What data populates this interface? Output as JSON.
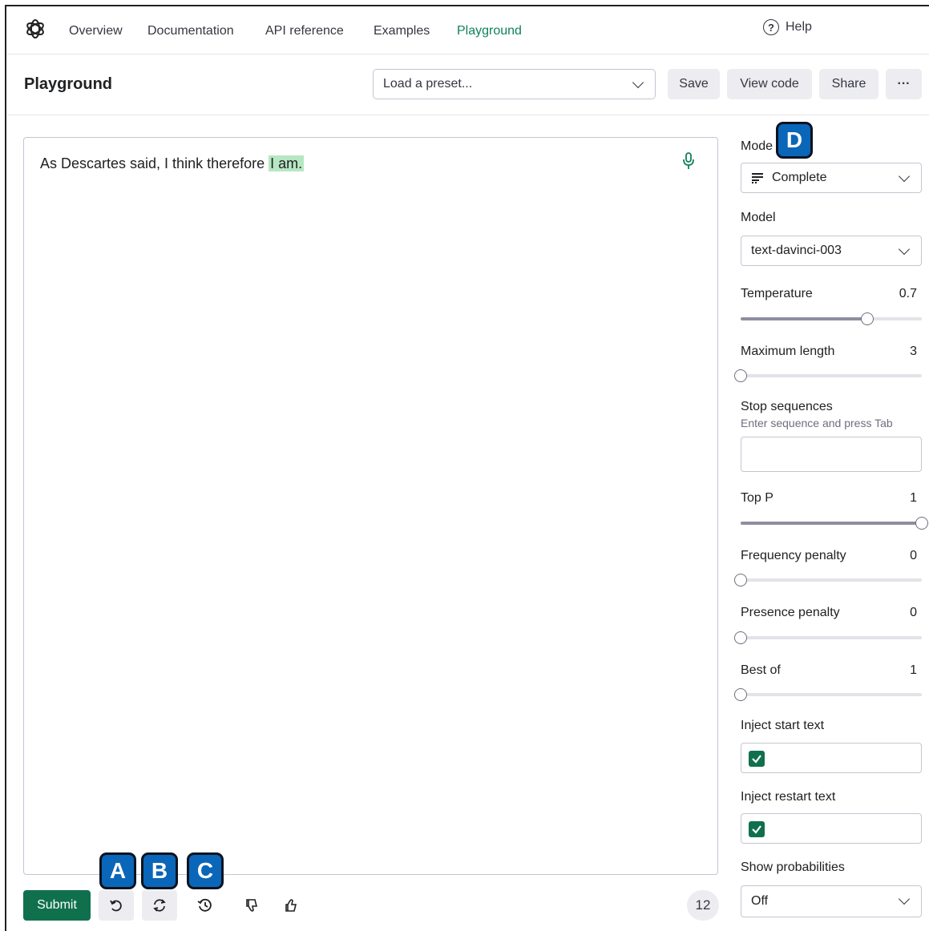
{
  "nav": {
    "items": [
      "Overview",
      "Documentation",
      "API reference",
      "Examples",
      "Playground"
    ],
    "active": "Playground",
    "help": "Help"
  },
  "header": {
    "title": "Playground",
    "preset_placeholder": "Load a preset...",
    "save": "Save",
    "view_code": "View code",
    "share": "Share",
    "more": "···"
  },
  "editor": {
    "prompt_text": "As Descartes said, I think therefore ",
    "completion_text": "I am."
  },
  "bottom": {
    "submit": "Submit",
    "token_count": "12"
  },
  "callouts": [
    "A",
    "B",
    "C",
    "D"
  ],
  "settings": {
    "mode_label": "Mode",
    "mode_value": "Complete",
    "model_label": "Model",
    "model_value": "text-davinci-003",
    "temperature": {
      "label": "Temperature",
      "value": "0.7",
      "fraction": 0.7
    },
    "max_length": {
      "label": "Maximum length",
      "value": "3",
      "fraction": 0.0
    },
    "stop_label": "Stop sequences",
    "stop_hint": "Enter sequence and press Tab",
    "top_p": {
      "label": "Top P",
      "value": "1",
      "fraction": 1.0
    },
    "frequency_penalty": {
      "label": "Frequency penalty",
      "value": "0",
      "fraction": 0.0
    },
    "presence_penalty": {
      "label": "Presence penalty",
      "value": "0",
      "fraction": 0.0
    },
    "best_of": {
      "label": "Best of",
      "value": "1",
      "fraction": 0.0
    },
    "inject_start_label": "Inject start text",
    "inject_start_checked": true,
    "inject_restart_label": "Inject restart text",
    "inject_restart_checked": true,
    "show_prob_label": "Show probabilities",
    "show_prob_value": "Off"
  },
  "colors": {
    "brand_green": "#10704e",
    "highlight": "#b6e7c3",
    "callout_blue": "#0a66b8"
  }
}
